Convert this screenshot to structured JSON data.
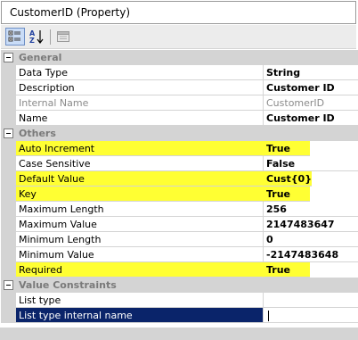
{
  "title": "CustomerID (Property)",
  "toolbar": {
    "buttons": [
      {
        "name": "categorized-icon",
        "active": true
      },
      {
        "name": "alphabetical-sort-icon",
        "active": false
      },
      {
        "name": "property-pages-icon",
        "active": false
      }
    ]
  },
  "grid": {
    "categories": {
      "general": "General",
      "others": "Others",
      "value_constraints": "Value Constraints"
    },
    "general": [
      {
        "name": "Data Type",
        "value": "String"
      },
      {
        "name": "Description",
        "value": "Customer ID"
      },
      {
        "name": "Internal Name",
        "value": "CustomerID",
        "readonly": true
      },
      {
        "name": "Name",
        "value": "Customer ID"
      }
    ],
    "others": [
      {
        "name": "Auto Increment",
        "value": "True",
        "highlighted": true
      },
      {
        "name": "Case Sensitive",
        "value": "False"
      },
      {
        "name": "Default Value",
        "value": "Cust{0}",
        "highlighted": true
      },
      {
        "name": "Key",
        "value": "True",
        "highlighted": true
      },
      {
        "name": "Maximum Length",
        "value": "256"
      },
      {
        "name": "Maximum Value",
        "value": "2147483647"
      },
      {
        "name": "Minimum Length",
        "value": "0"
      },
      {
        "name": "Minimum Value",
        "value": "-2147483648"
      },
      {
        "name": "Required",
        "value": "True",
        "highlighted": true
      }
    ],
    "value_constraints": [
      {
        "name": "List type",
        "value": ""
      },
      {
        "name": "List type internal name",
        "value": "",
        "selected": true
      }
    ]
  },
  "colors": {
    "highlight": "#ffff33",
    "selection": "#0a246a",
    "category_bg": "#d4d4d4"
  }
}
